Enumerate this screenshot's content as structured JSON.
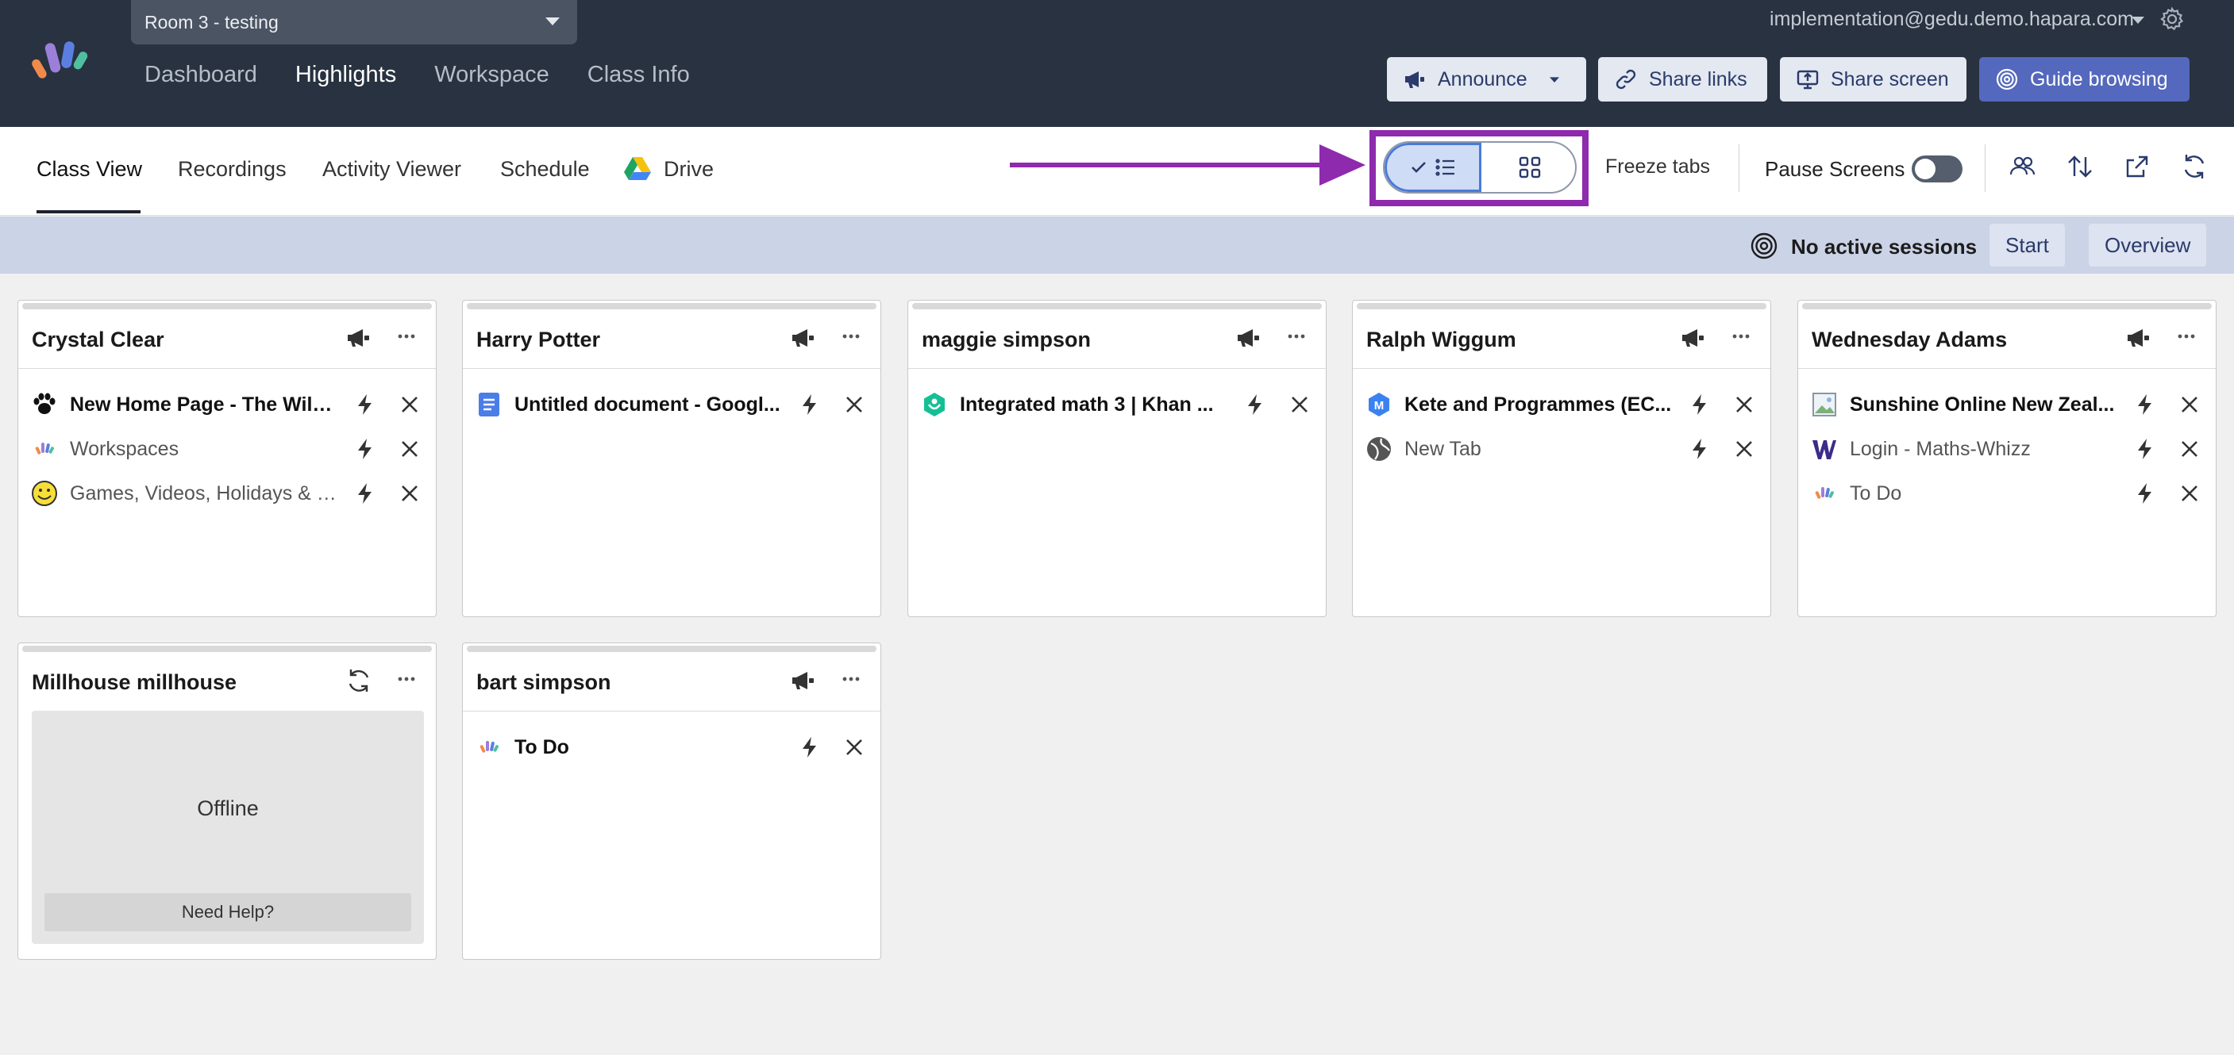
{
  "room": {
    "label": "Room 3 - testing"
  },
  "nav": [
    "Dashboard",
    "Highlights",
    "Workspace",
    "Class Info"
  ],
  "user": {
    "email": "implementation@gedu.demo.hapara.com"
  },
  "toolbar": {
    "announce": "Announce",
    "share_links": "Share links",
    "share_screen": "Share screen",
    "guide_browsing": "Guide browsing"
  },
  "subtabs": [
    "Class View",
    "Recordings",
    "Activity Viewer",
    "Schedule",
    "Drive"
  ],
  "controls": {
    "freeze": "Freeze tabs",
    "pause": "Pause Screens",
    "pause_on": false
  },
  "sessions": {
    "status": "No active sessions",
    "start": "Start",
    "overview": "Overview"
  },
  "students": [
    {
      "name": "Crystal Clear",
      "tabs": [
        {
          "title": "New Home Page - The Wild...",
          "icon": "paw-icon",
          "active": true
        },
        {
          "title": "Workspaces",
          "icon": "hapara-icon",
          "active": false
        },
        {
          "title": "Games, Videos, Holidays & C...",
          "icon": "smiley-icon",
          "active": false
        }
      ]
    },
    {
      "name": "Harry Potter",
      "tabs": [
        {
          "title": "Untitled document - Googl...",
          "icon": "google-docs-icon",
          "active": true
        }
      ]
    },
    {
      "name": "maggie simpson",
      "tabs": [
        {
          "title": "Integrated math 3 | Khan ...",
          "icon": "khan-academy-icon",
          "active": true
        }
      ]
    },
    {
      "name": "Ralph Wiggum",
      "tabs": [
        {
          "title": "Kete and Programmes (EC...",
          "icon": "m-badge-icon",
          "active": true
        },
        {
          "title": "New Tab",
          "icon": "globe-icon",
          "active": false
        }
      ]
    },
    {
      "name": "Wednesday Adams",
      "tabs": [
        {
          "title": "Sunshine Online New Zeal...",
          "icon": "image-icon",
          "active": true
        },
        {
          "title": "Login - Maths-Whizz",
          "icon": "w-logo-icon",
          "active": false
        },
        {
          "title": "To Do",
          "icon": "hapara-icon",
          "active": false
        }
      ]
    },
    {
      "name": "Millhouse millhouse",
      "offline": "Offline",
      "help": "Need Help?"
    },
    {
      "name": "bart simpson",
      "tabs": [
        {
          "title": "To Do",
          "icon": "hapara-icon",
          "active": true
        }
      ]
    }
  ],
  "colors": {
    "topbar": "#283240",
    "primary": "#5468bd",
    "highlight": "#8e2aad",
    "sessionbar": "#cbd3e6"
  }
}
